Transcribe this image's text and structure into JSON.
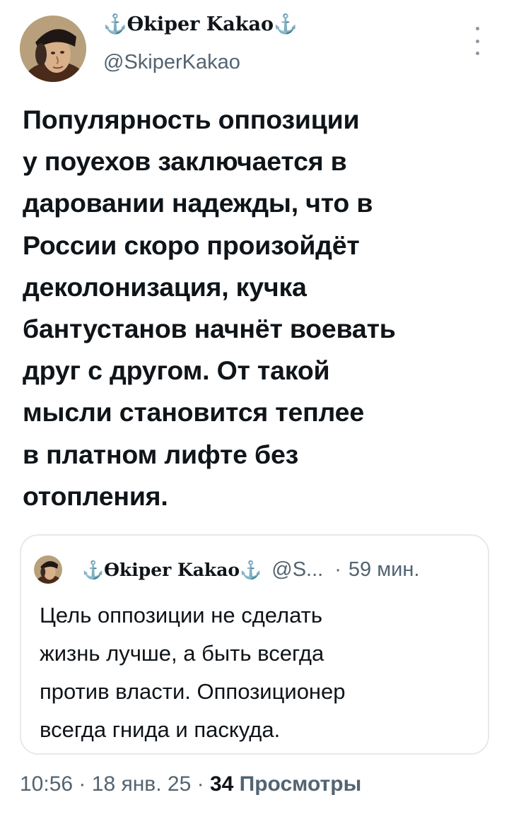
{
  "author": {
    "display_name": "⚓Ѳkiper Kakao⚓",
    "handle": "@SkiperKakao"
  },
  "tweet": {
    "text": "Популярность оппозиции\nу поуехов заключается в\nдаровании надежды, что в\nРоссии скоро произойдёт\nдеколонизация, кучка\nбантустанов начнёт воевать\nдруг с другом. От такой\nмысли становится теплее\nв платном лифте без\nотопления."
  },
  "quoted_tweet": {
    "display_name": "⚓Ѳkiper Kakao⚓",
    "handle": "@S...",
    "separator": "·",
    "time": "59 мин.",
    "text": "Цель оппозиции не сделать\nжизнь лучше, а быть всегда\nпротив власти. Оппозиционер\nвсегда гнида и паскуда."
  },
  "footer": {
    "time": "10:56",
    "sep1": "·",
    "date": "18 янв. 25",
    "sep2": "·",
    "views_count": "34",
    "views_label": "Просмотры"
  },
  "icons": {
    "avatar": "portrait-avatar",
    "more": "more-vertical-icon"
  }
}
